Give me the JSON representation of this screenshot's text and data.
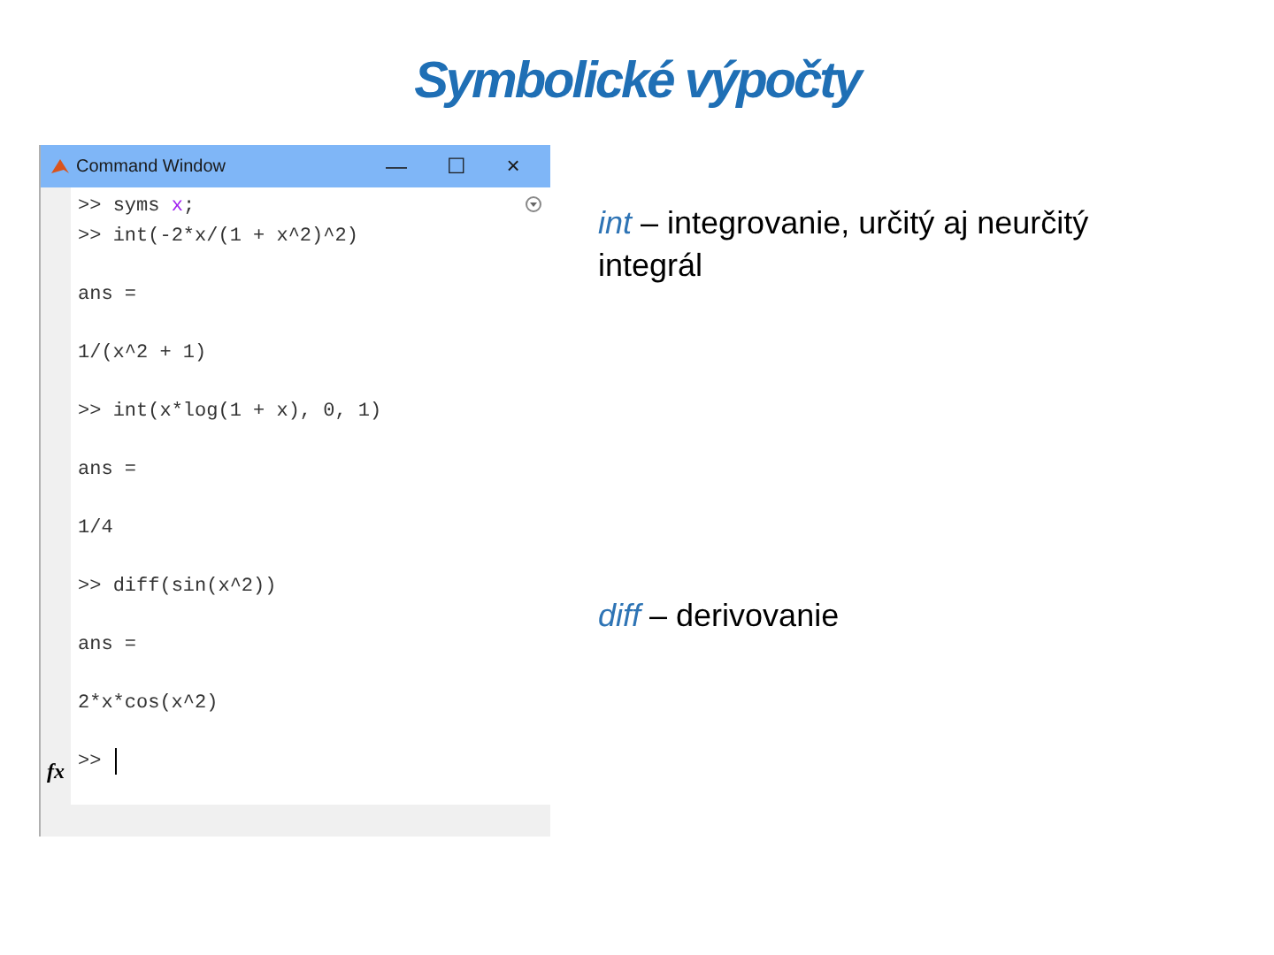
{
  "slide_title": "Symbolické výpočty",
  "window": {
    "title": "Command Window",
    "minimize": "—",
    "maximize": "☐",
    "close": "×",
    "lines": [
      {
        "kind": "command",
        "prompt": ">>",
        "segments": [
          {
            "kind": "plain",
            "text": "syms "
          },
          {
            "kind": "variable",
            "text": "x"
          },
          {
            "kind": "plain",
            "text": ";"
          }
        ]
      },
      {
        "kind": "command",
        "prompt": ">>",
        "segments": [
          {
            "kind": "plain",
            "text": "int(-2*x/(1 + x^2)^2)"
          }
        ]
      },
      {
        "kind": "result_label",
        "text": "ans ="
      },
      {
        "kind": "result",
        "text": "1/(x^2 + 1)"
      },
      {
        "kind": "command",
        "prompt": ">>",
        "segments": [
          {
            "kind": "plain",
            "text": "int(x*log(1 + x), 0, 1)"
          }
        ]
      },
      {
        "kind": "result_label",
        "text": "ans ="
      },
      {
        "kind": "result",
        "text": "1/4"
      },
      {
        "kind": "command",
        "prompt": ">>",
        "segments": [
          {
            "kind": "plain",
            "text": "diff(sin(x^2))"
          }
        ]
      },
      {
        "kind": "result_label",
        "text": "ans ="
      },
      {
        "kind": "result",
        "text": "2*x*cos(x^2)"
      }
    ],
    "input": {
      "fx": "fx",
      "prompt": ">>"
    }
  },
  "notes": [
    {
      "term": "int",
      "text": " – integrovanie, určitý aj neurčitý integrál"
    },
    {
      "term": "diff",
      "text": " – derivovanie"
    }
  ]
}
